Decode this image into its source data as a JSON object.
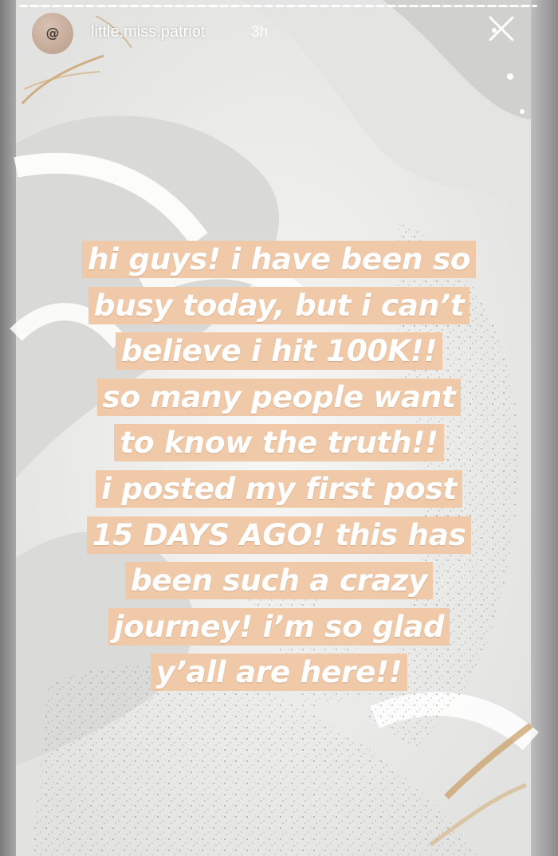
{
  "story": {
    "username": "little.miss.patriot",
    "timestamp": "3h",
    "avatar_icon": "at-sign-icon",
    "close_icon": "close-icon",
    "caption_lines": [
      "hi guys! i have been so",
      "busy today, but i can’t",
      "believe i hit 100K!!",
      "so many people want",
      "to know the truth!!",
      "i posted my first post",
      "15 DAYS AGO! this has",
      "been such a crazy",
      "journey! i’m so glad",
      "y’all are here!!"
    ]
  },
  "colors": {
    "caption_highlight": "#efc9a8",
    "caption_text": "#ffffff",
    "background": "#ececea",
    "accent_gold": "#c9a06a"
  }
}
